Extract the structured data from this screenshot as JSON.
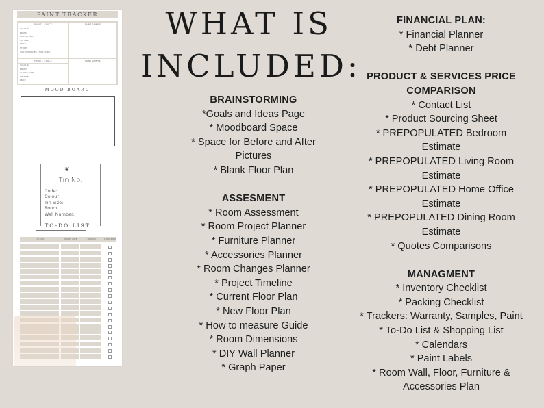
{
  "preview": {
    "paint_tracker": {
      "title": "PAINT TRACKER",
      "blocks": [
        {
          "left_header": "PAINT - SPACE",
          "fields": [
            "Colour",
            "Brand",
            "Gloss / Matt",
            "Tin Size",
            "Price",
            "Store",
            "Custom Order / Tint Code"
          ],
          "right_header": "PAINT SAMPLE"
        },
        {
          "left_header": "PAINT - SPACE",
          "fields": [
            "Colour",
            "Brand",
            "Gloss / Matt",
            "Tin Size",
            "Price"
          ],
          "right_header": "PAINT SAMPLE"
        }
      ]
    },
    "mood_board": {
      "title": "MOOD BOARD"
    },
    "tin_label": {
      "leaf_icon": "fern-leaf-icon",
      "title": "Tin No.",
      "fields": [
        "Code:",
        "Colour:",
        "Tin Size:",
        "Room:",
        "Wall Number:"
      ]
    },
    "todo": {
      "title": "TO-DO LIST",
      "columns": [
        "ACTION",
        "TARGET DATE",
        "PRIORITY",
        "COMPLETED"
      ],
      "row_count": 19
    }
  },
  "heading": {
    "line1": "WHAT IS",
    "line2": "INCLUDED:"
  },
  "middle_sections": [
    {
      "title": "BRAINSTORMING",
      "lines": [
        "*Goals and Ideas Page",
        "* Moodboard Space",
        "* Space for Before and After",
        "Pictures",
        "* Blank Floor Plan"
      ]
    },
    {
      "title": "ASSESMENT",
      "lines": [
        "* Room Assessment",
        "* Room Project Planner",
        "* Furniture Planner",
        "* Accessories Planner",
        "* Room Changes Planner",
        "* Project Timeline",
        "* Current Floor Plan",
        "* New Floor Plan",
        "* How to measure Guide",
        "* Room Dimensions",
        "* DIY Wall Planner",
        "* Graph Paper"
      ]
    }
  ],
  "right_sections": [
    {
      "title_lines": [
        "FINANCIAL PLAN:"
      ],
      "lines": [
        "* Financial Planner",
        "* Debt Planner"
      ]
    },
    {
      "title_lines": [
        "PRODUCT & SERVICES PRICE",
        "COMPARISON"
      ],
      "lines": [
        "* Contact List",
        "* Product Sourcing Sheet",
        "* PREPOPULATED Bedroom",
        "Estimate",
        "* PREPOPULATED Living Room",
        "Estimate",
        "* PREPOPULATED Home Office",
        "Estimate",
        "* PREPOPULATED Dining Room",
        "Estimate",
        "* Quotes Comparisons"
      ]
    },
    {
      "title_lines": [
        "MANAGMENT"
      ],
      "lines": [
        "* Inventory Checklist",
        "* Packing Checklist",
        "* Trackers: Warranty, Samples, Paint",
        "* To-Do List & Shopping List",
        "* Calendars",
        "* Paint Labels",
        "* Room Wall, Floor, Furniture &",
        "Accessories Plan"
      ]
    }
  ]
}
